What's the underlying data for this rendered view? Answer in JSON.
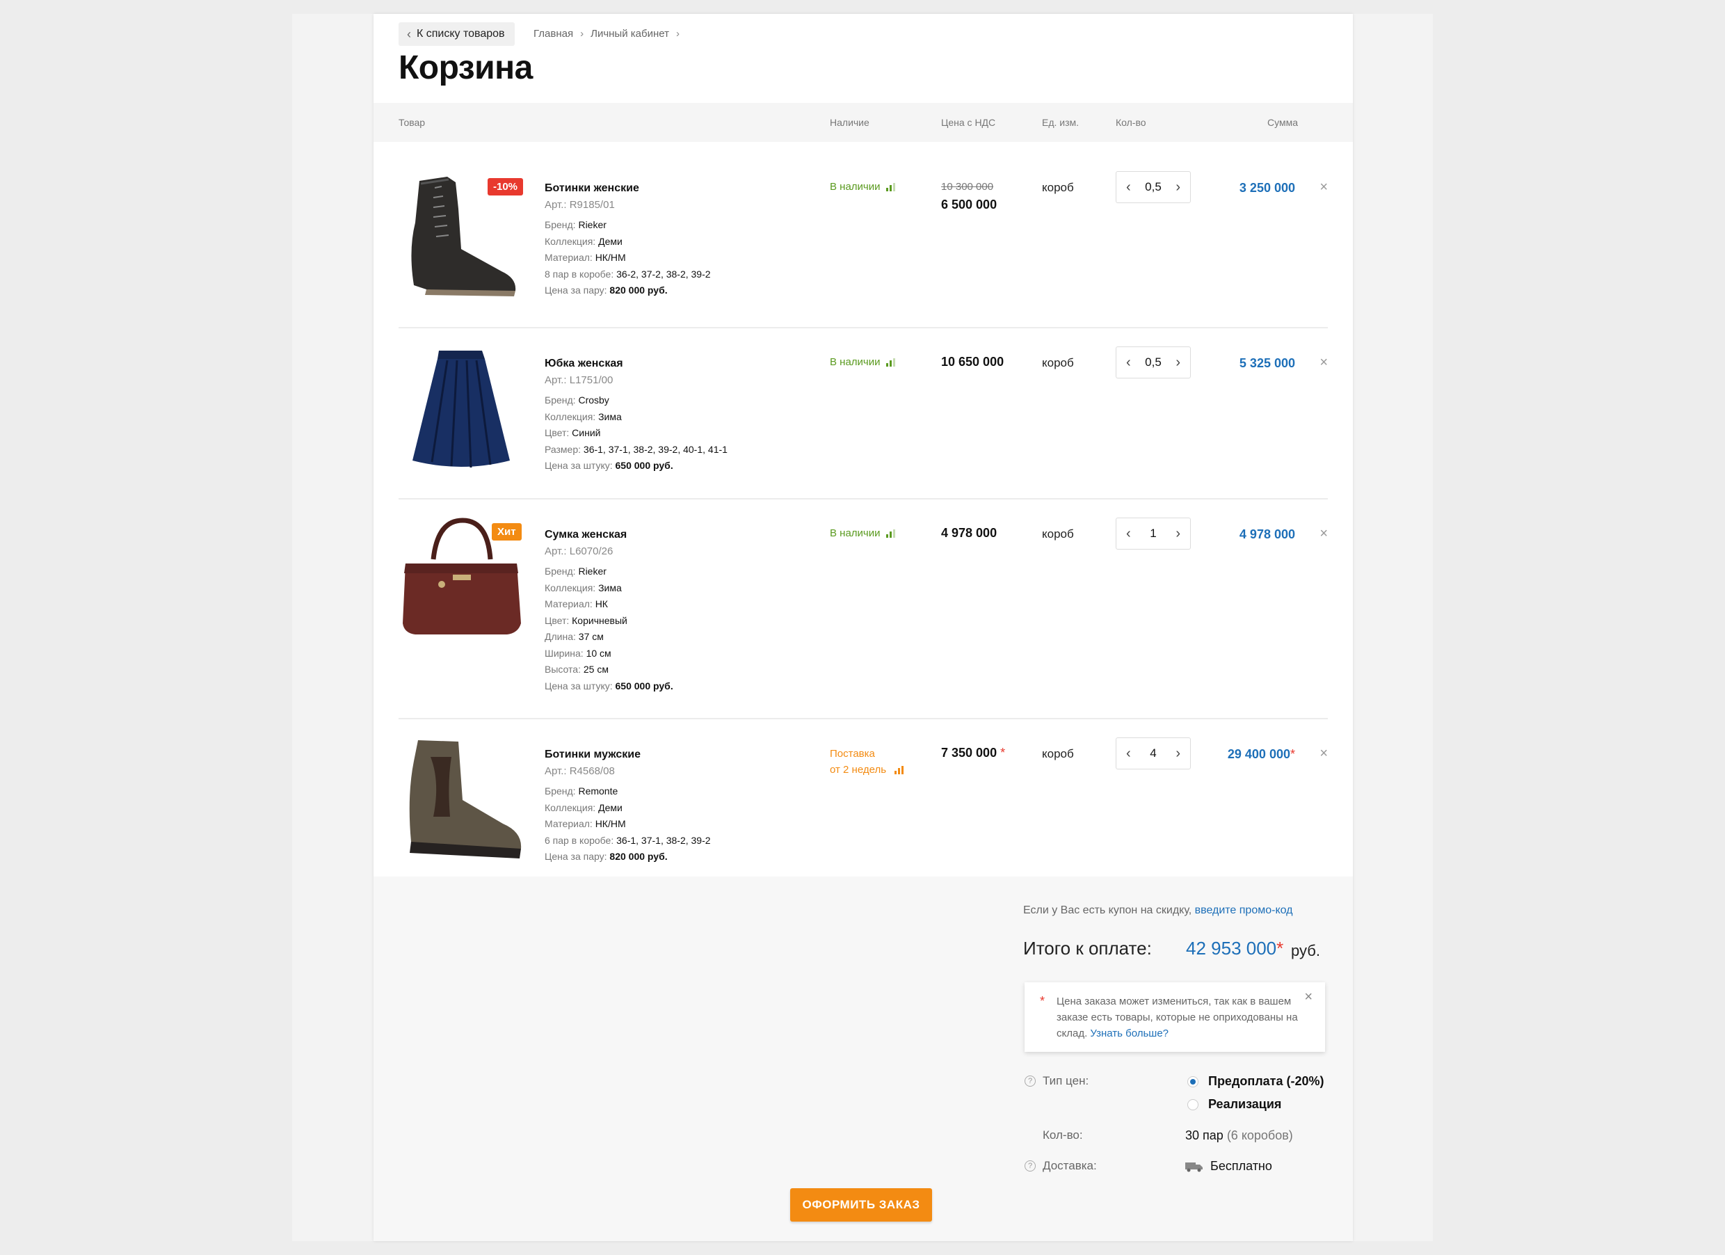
{
  "nav": {
    "back_label": "К списку товаров",
    "breadcrumbs": [
      "Главная",
      "Личный кабинет"
    ]
  },
  "page_title": "Корзина",
  "table_headers": {
    "product": "Товар",
    "availability": "Наличие",
    "price": "Цена с НДС",
    "unit": "Ед. изм.",
    "qty": "Кол-во",
    "sum": "Сумма"
  },
  "items": [
    {
      "image": "womens-boot-image",
      "badge": "-10%",
      "name": "Ботинки женские",
      "sku": "Арт.: R9185/01",
      "attrs": [
        {
          "label": "Бренд: ",
          "value": "Rieker"
        },
        {
          "label": "Коллекция: ",
          "value": "Деми"
        },
        {
          "label": "Материал: ",
          "value": "НК/НМ"
        },
        {
          "label": "8 пар в коробе: ",
          "value": "36-2, 37-2, 38-2, 39-2"
        }
      ],
      "price_note_label": "Цена за пару: ",
      "price_note_value": "820 000 руб.",
      "availability": "В наличии",
      "old_price": "10 300 000",
      "price": "6 500 000",
      "unit": "короб",
      "qty": "0,5",
      "sum": "3 250 000"
    },
    {
      "image": "womens-skirt-image",
      "name": "Юбка женская",
      "sku": "Арт.: L1751/00",
      "attrs": [
        {
          "label": "Бренд: ",
          "value": "Crosby"
        },
        {
          "label": "Коллекция: ",
          "value": "Зима"
        },
        {
          "label": "Цвет: ",
          "value": "Синий"
        },
        {
          "label": "Размер: ",
          "value": "36-1, 37-1, 38-2, 39-2, 40-1, 41-1"
        }
      ],
      "price_note_label": "Цена за штуку: ",
      "price_note_value": "650 000 руб.",
      "availability": "В наличии",
      "price": "10 650 000",
      "unit": "короб",
      "qty": "0,5",
      "sum": "5 325 000"
    },
    {
      "image": "womens-bag-image",
      "badge": "Хит",
      "name": "Сумка женская",
      "sku": "Арт.: L6070/26",
      "attrs": [
        {
          "label": "Бренд: ",
          "value": "Rieker"
        },
        {
          "label": "Коллекция: ",
          "value": "Зима"
        },
        {
          "label": "Материал: ",
          "value": "НК"
        },
        {
          "label": "Цвет: ",
          "value": "Коричневый"
        },
        {
          "label": "Длина: ",
          "value": "37 см"
        },
        {
          "label": "Ширина: ",
          "value": "10 см"
        },
        {
          "label": "Высота: ",
          "value": "25 см"
        }
      ],
      "price_note_label": "Цена за штуку: ",
      "price_note_value": "650 000 руб.",
      "availability": "В наличии",
      "price": "4 978 000",
      "unit": "короб",
      "qty": "1",
      "sum": "4 978 000"
    },
    {
      "image": "mens-boot-image",
      "name": "Ботинки мужские",
      "sku": "Арт.: R4568/08",
      "attrs": [
        {
          "label": "Бренд: ",
          "value": "Remonte"
        },
        {
          "label": "Коллекция: ",
          "value": "Деми"
        },
        {
          "label": "Материал: ",
          "value": "НК/НМ"
        },
        {
          "label": "6 пар в коробе: ",
          "value": "36-1, 37-1, 38-2, 39-2"
        }
      ],
      "price_note_label": "Цена за пару: ",
      "price_note_value": "820 000 руб.",
      "availability_line1": "Поставка",
      "availability_line2": "от 2 недель",
      "price": "7 350 000",
      "unit": "короб",
      "qty": "4",
      "sum": "29 400 000",
      "asterisk": "*"
    }
  ],
  "summary": {
    "promo_text": "Если у Вас есть купон на скидку, ",
    "promo_link": "введите промо-код",
    "total_label": "Итого к оплате:",
    "total_value": "42 953 000",
    "asterisk": "*",
    "currency": "руб.",
    "note_text": "Цена заказа может измениться, так как в вашем заказе есть товары, которые не оприходованы на склад. ",
    "note_link": "Узнать больше?",
    "price_type_label": "Тип цен:",
    "price_type_options": [
      "Предоплата (-20%)",
      "Реализация"
    ],
    "price_type_selected": 0,
    "qty_label": "Кол-во:",
    "qty_value": "30 пар",
    "qty_boxes": "(6 коробов)",
    "delivery_label": "Доставка:",
    "delivery_value": "Бесплатно",
    "checkout_label": "ОФОРМИТЬ ЗАКАЗ"
  },
  "colors": {
    "accent_blue": "#1d6fb8",
    "in_stock_green": "#5a9a1f",
    "orange": "#f38b12",
    "badge_red": "#e8392e"
  }
}
